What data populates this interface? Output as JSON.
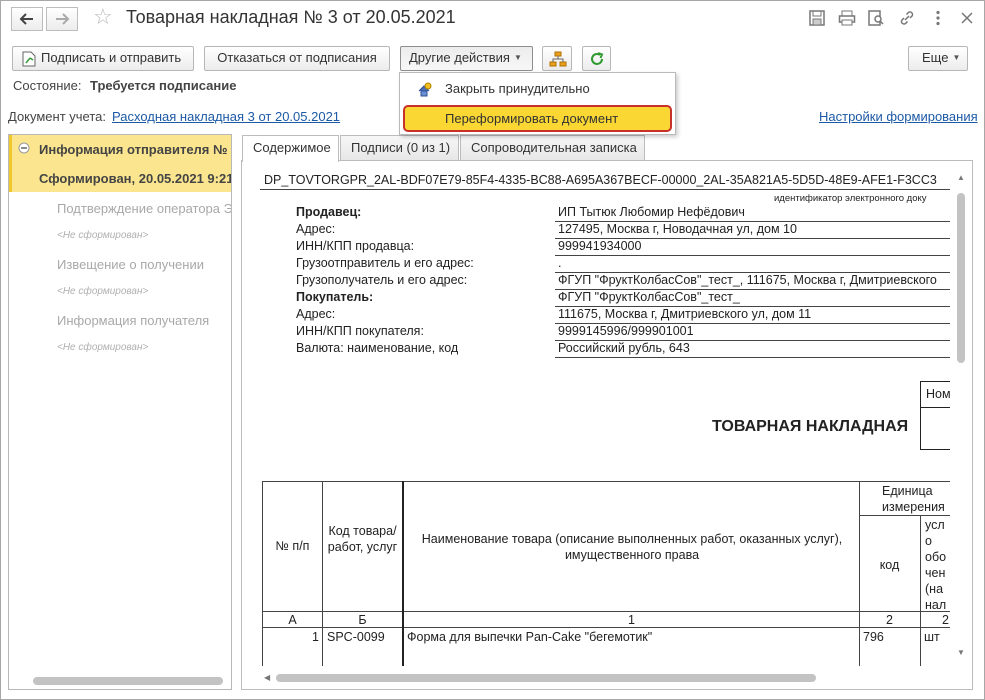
{
  "window": {
    "title": "Товарная накладная № 3 от 20.05.2021"
  },
  "toolbar": {
    "sign_send_label": "Подписать и отправить",
    "refuse_label": "Отказаться от подписания",
    "other_actions_label": "Другие действия",
    "more_label": "Еще"
  },
  "dropdown": {
    "items": [
      {
        "label": "Закрыть принудительно",
        "icon": "close-force-icon"
      },
      {
        "label": "Переформировать документ",
        "icon": ""
      }
    ]
  },
  "status": {
    "label": "Состояние:",
    "value": "Требуется подписание"
  },
  "doc_ref": {
    "label": "Документ учета:",
    "link": "Расходная накладная 3 от 20.05.2021",
    "settings_link": "Настройки формирования"
  },
  "tree": {
    "selected_line1": "Информация отправителя №",
    "selected_line2": "Сформирован, 20.05.2021 9:21",
    "items": [
      {
        "label": "Подтверждение оператора Э",
        "note": "<Не сформирован>"
      },
      {
        "label": "Извещение о получении",
        "note": "<Не сформирован>"
      },
      {
        "label": "Информация получателя",
        "note": "<Не сформирован>"
      }
    ]
  },
  "tabs": [
    {
      "label": "Содержимое"
    },
    {
      "label": "Подписи (0 из 1)"
    },
    {
      "label": "Сопроводительная записка"
    }
  ],
  "document": {
    "file_id": "DP_TOVTORGPR_2AL-BDF07E79-85F4-4335-BC88-A695A367BECF-00000_2AL-35A821A5-5D5D-48E9-AFE1-F3CC3",
    "file_id_caption": "идентификатор электронного доку",
    "fields": [
      {
        "label": "Продавец:",
        "value": "ИП Тытюк Любомир Нефёдович",
        "bold": true
      },
      {
        "label": "Адрес:",
        "value": "127495, Москва г, Новодачная ул, дом 10",
        "bold": false
      },
      {
        "label": "ИНН/КПП продавца:",
        "value": "999941934000",
        "bold": false
      },
      {
        "label": "Грузоотправитель и его адрес:",
        "value": ".",
        "bold": false
      },
      {
        "label": "Грузополучатель и его адрес:",
        "value": "ФГУП \"ФруктКолбасСов\"_тест_, 111675, Москва г, Дмитриевского",
        "bold": false
      },
      {
        "label": "Покупатель:",
        "value": "ФГУП \"ФруктКолбасСов\"_тест_",
        "bold": true
      },
      {
        "label": "Адрес:",
        "value": "111675, Москва г, Дмитриевского ул, дом 11",
        "bold": false
      },
      {
        "label": "ИНН/КПП покупателя:",
        "value": "9999145996/999901001",
        "bold": false
      },
      {
        "label": "Валюта: наименование, код",
        "value": "Российский рубль, 643",
        "bold": false
      }
    ],
    "nomer_header": "Номе",
    "doc_title": "ТОВАРНАЯ НАКЛАДНАЯ",
    "table": {
      "col_num": "№ п/п",
      "col_code": "Код товара/ работ, услуг",
      "col_name": "Наименование товара (описание выполненных работ, оказанных услуг), имущественного права",
      "col_unit": "Единица измерения",
      "col_unit_code": "код",
      "col_unit_name": "усл о обо чен (на нал",
      "idx": [
        "А",
        "Б",
        "1",
        "2",
        "2"
      ],
      "rows": [
        {
          "num": "1",
          "code": "SPC-0099",
          "name": "Форма для выпечки Pan-Cake \"бегемотик\"",
          "unit_code": "796",
          "unit_name": "шт"
        }
      ]
    }
  },
  "colors": {
    "accent_yellow": "#fbe68f",
    "highlight": "#fad733",
    "highlight_border": "#c8312b",
    "link": "#1d5aa6"
  }
}
